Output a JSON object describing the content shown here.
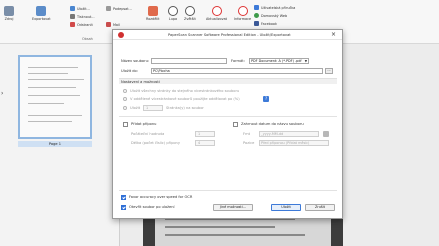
{
  "ribbon": {
    "buttons": [
      {
        "label": "Zdroj",
        "icon": "scanner-icon"
      },
      {
        "label": "Exportovat",
        "icon": "export-icon"
      },
      {
        "label": "Rozdělit",
        "icon": "split-icon"
      },
      {
        "label": "Lupa",
        "icon": "zoom-in-icon"
      },
      {
        "label": "Zvětšit",
        "icon": "zoom-icon"
      },
      {
        "label": "Aktualizovat",
        "icon": "refresh-icon"
      },
      {
        "label": "Informace",
        "icon": "info-icon"
      }
    ],
    "small_items": [
      {
        "label": "Uložit...",
        "icon": "save-icon"
      },
      {
        "label": "Tisknout...",
        "icon": "print-icon"
      },
      {
        "label": "Odstranit",
        "icon": "delete-icon"
      },
      {
        "label": "Podepsat...",
        "icon": "sign-icon"
      },
      {
        "label": "Mail",
        "icon": "mail-icon"
      },
      {
        "label": "Uživatelská příručka",
        "icon": "help-book-icon"
      },
      {
        "label": "Domovský Web",
        "icon": "globe-icon"
      },
      {
        "label": "Facebook",
        "icon": "facebook-icon"
      }
    ],
    "group_label": "Obsah"
  },
  "thumbnails": {
    "page_label": "Page 1"
  },
  "dialog": {
    "title": "PaperScan Scanner Software Professional Edition - Uložit/Exportovat",
    "filename_label": "Název souboru:",
    "filename_value": "",
    "format_label": "Formát:",
    "format_value": "PDF Document: A (*.PDF) .pdf",
    "folder_label": "Uložit do:",
    "folder_value": "PC\\Plocha",
    "browse_label": "...",
    "section_pages": "Nastavení a možnosti",
    "option_all": "Uložit všechny stránky do stejného vícestránkového souboru",
    "option_each": "V oddělené vícestránkové souborů použijte oddělovat po (%)",
    "option_range": "Uložit",
    "range_value": "1",
    "range_suffix": "Stránka(y) na soubor",
    "password_label": "Přidat příponu",
    "add_date_label": "Zahrnout datum do názvu souboru",
    "start_label": "Počáteční hodnota",
    "start_value": "1",
    "digits_label": "Délka (počet číslic) přípony",
    "digits_value": "4",
    "format_date_label": "Fmt",
    "format_date_value": "_yyyy-MM-dd",
    "position_label": "Pozice",
    "position_value": "Před příponou (Přidat měsíc)",
    "favor_speed_label": "Favor accuracy over speed for OCR",
    "open_after_label": "Otevřít soubor po uložení",
    "more_button": "Jiné možnosti...",
    "save_button": "Uložit",
    "cancel_button": "Zrušit"
  }
}
